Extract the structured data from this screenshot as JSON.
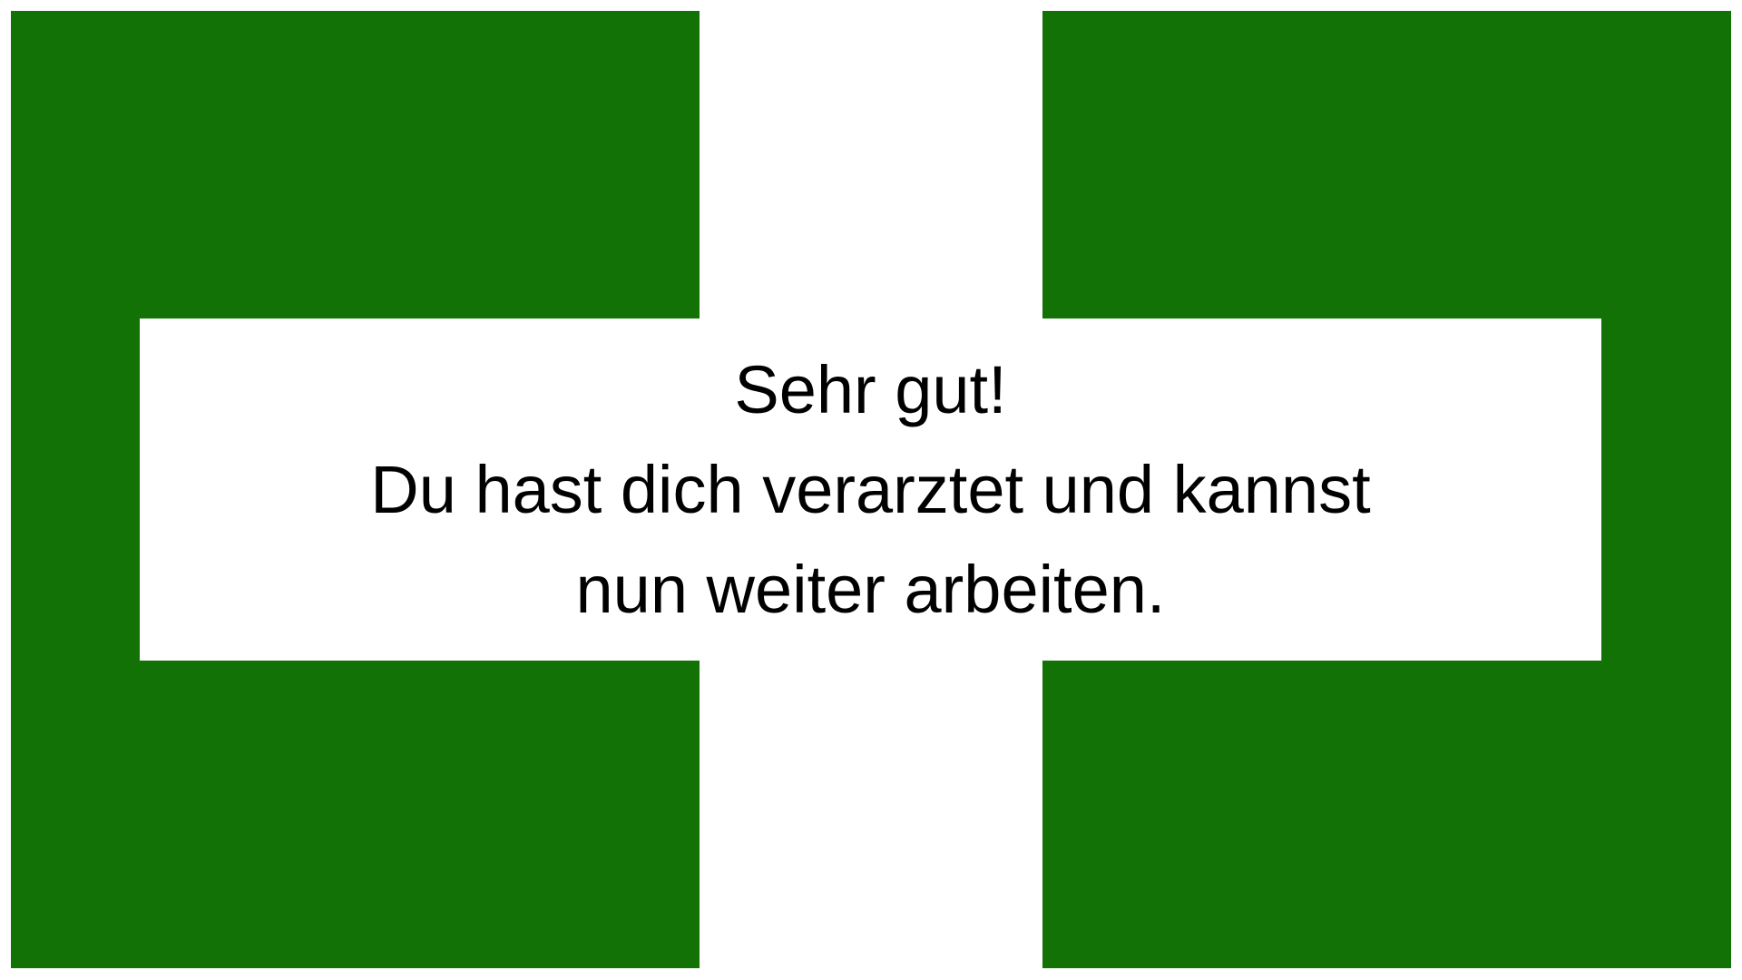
{
  "colors": {
    "panel_green": "#137206",
    "background": "#ffffff",
    "text": "#000000"
  },
  "message": {
    "line1": "Sehr gut!",
    "line2": "Du hast dich verarztet und kannst",
    "line3": "nun weiter arbeiten."
  }
}
